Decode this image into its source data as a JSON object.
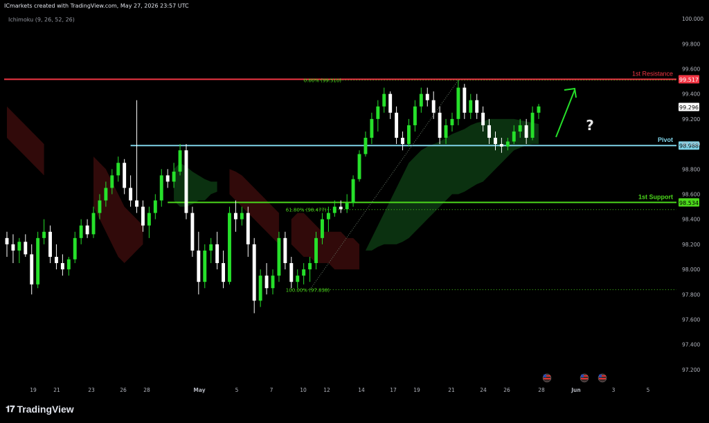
{
  "header": {
    "attribution": "ICmarkets created with TradingView.com, May 27, 2026 23:57 UTC",
    "indicator": "Ichimoku (9, 26, 52, 26)"
  },
  "brand": {
    "logo_icon": "tradingview-logo-icon",
    "name": "TradingView"
  },
  "colors": {
    "background": "#000000",
    "resistance": "#f23645",
    "pivot": "#7fd3e8",
    "support": "#4cd91c",
    "fib": "#4cd91c",
    "candle_up": "#26e02a",
    "candle_down": "#ffffff",
    "kumo_bull": "#0d3a13",
    "kumo_bear": "#3a0c0c",
    "arrow": "#26e02a"
  },
  "chart_data": {
    "type": "candlestick",
    "symbol_timeframe": "",
    "ylim": [
      97.1,
      100.05
    ],
    "y_ticks": [
      "100.000",
      "99.800",
      "99.600",
      "99.400",
      "99.200",
      "99.000",
      "98.800",
      "98.600",
      "98.400",
      "98.200",
      "98.000",
      "97.800",
      "97.600",
      "97.400",
      "97.200"
    ],
    "x_ticks": [
      "19",
      "21",
      "23",
      "26",
      "28",
      "May",
      "5",
      "7",
      "10",
      "12",
      "14",
      "17",
      "19",
      "21",
      "24",
      "26",
      "28",
      "Jun",
      "3",
      "5"
    ],
    "levels": [
      {
        "name": "1st Resistance",
        "price_label": "99.517",
        "value": 99.517,
        "color_key": "resistance"
      },
      {
        "name": "Pivot",
        "price_label": "98.988",
        "value": 98.988,
        "color_key": "pivot"
      },
      {
        "name": "1st Support",
        "price_label": "98.534",
        "value": 98.534,
        "color_key": "support"
      }
    ],
    "current_price": {
      "price_label": "99.296",
      "value": 99.296
    },
    "fib_levels": [
      {
        "label": "0.00% (99.510)",
        "value": 99.51
      },
      {
        "label": "61.80% (98.477)",
        "value": 98.477
      },
      {
        "label": "100.00% (97.838)",
        "value": 97.838
      }
    ],
    "annotation": {
      "symbol": "?",
      "direction": "up"
    },
    "event_markers": [
      "us-flag-icon",
      "us-flag-icon",
      "us-flag-icon"
    ],
    "candles": [
      [
        98.25,
        98.3,
        98.1,
        98.2
      ],
      [
        98.2,
        98.28,
        98.05,
        98.15
      ],
      [
        98.15,
        98.25,
        98.05,
        98.22
      ],
      [
        98.22,
        98.28,
        98.1,
        98.12
      ],
      [
        98.12,
        98.2,
        97.8,
        97.88
      ],
      [
        97.88,
        98.3,
        97.85,
        98.25
      ],
      [
        98.25,
        98.4,
        98.2,
        98.3
      ],
      [
        98.3,
        98.35,
        98.05,
        98.1
      ],
      [
        98.1,
        98.2,
        98.0,
        98.05
      ],
      [
        98.05,
        98.12,
        97.95,
        98.0
      ],
      [
        98.0,
        98.1,
        97.95,
        98.08
      ],
      [
        98.08,
        98.3,
        98.05,
        98.25
      ],
      [
        98.25,
        98.4,
        98.2,
        98.35
      ],
      [
        98.35,
        98.4,
        98.25,
        98.28
      ],
      [
        98.28,
        98.5,
        98.25,
        98.45
      ],
      [
        98.45,
        98.6,
        98.4,
        98.55
      ],
      [
        98.55,
        98.7,
        98.5,
        98.65
      ],
      [
        98.65,
        98.8,
        98.6,
        98.75
      ],
      [
        98.75,
        98.9,
        98.7,
        98.85
      ],
      [
        98.85,
        98.88,
        98.6,
        98.65
      ],
      [
        98.65,
        98.75,
        98.5,
        98.55
      ],
      [
        98.55,
        99.35,
        98.45,
        98.5
      ],
      [
        98.5,
        98.55,
        98.3,
        98.35
      ],
      [
        98.35,
        98.5,
        98.25,
        98.45
      ],
      [
        98.45,
        98.6,
        98.4,
        98.55
      ],
      [
        98.55,
        98.8,
        98.5,
        98.75
      ],
      [
        98.75,
        98.8,
        98.65,
        98.7
      ],
      [
        98.7,
        98.85,
        98.65,
        98.78
      ],
      [
        98.78,
        99.0,
        98.75,
        98.95
      ],
      [
        98.95,
        99.0,
        98.4,
        98.45
      ],
      [
        98.45,
        98.5,
        98.1,
        98.15
      ],
      [
        98.15,
        98.3,
        97.8,
        97.9
      ],
      [
        97.9,
        98.2,
        97.85,
        98.15
      ],
      [
        98.15,
        98.25,
        98.05,
        98.2
      ],
      [
        98.2,
        98.3,
        98.0,
        98.05
      ],
      [
        98.05,
        98.15,
        97.85,
        97.9
      ],
      [
        97.9,
        98.5,
        97.88,
        98.45
      ],
      [
        98.45,
        98.55,
        98.3,
        98.4
      ],
      [
        98.4,
        98.5,
        98.35,
        98.45
      ],
      [
        98.45,
        98.5,
        98.1,
        98.2
      ],
      [
        98.2,
        98.25,
        97.65,
        97.75
      ],
      [
        97.75,
        98.0,
        97.7,
        97.95
      ],
      [
        97.95,
        98.05,
        97.8,
        97.85
      ],
      [
        97.85,
        98.0,
        97.8,
        97.95
      ],
      [
        97.95,
        98.3,
        97.9,
        98.25
      ],
      [
        98.25,
        98.3,
        98.0,
        98.05
      ],
      [
        98.05,
        98.1,
        97.85,
        97.9
      ],
      [
        97.9,
        98.0,
        97.85,
        97.95
      ],
      [
        97.95,
        98.05,
        97.88,
        98.0
      ],
      [
        98.0,
        98.1,
        97.9,
        98.05
      ],
      [
        98.05,
        98.3,
        98.0,
        98.25
      ],
      [
        98.25,
        98.45,
        98.2,
        98.4
      ],
      [
        98.4,
        98.5,
        98.3,
        98.45
      ],
      [
        98.45,
        98.55,
        98.42,
        98.5
      ],
      [
        98.5,
        98.55,
        98.45,
        98.48
      ],
      [
        98.48,
        98.6,
        98.45,
        98.53
      ],
      [
        98.53,
        98.75,
        98.5,
        98.72
      ],
      [
        98.72,
        98.95,
        98.7,
        98.92
      ],
      [
        98.92,
        99.1,
        98.9,
        99.05
      ],
      [
        99.05,
        99.25,
        99.0,
        99.2
      ],
      [
        99.2,
        99.35,
        99.1,
        99.3
      ],
      [
        99.3,
        99.45,
        99.25,
        99.4
      ],
      [
        99.4,
        99.42,
        99.2,
        99.25
      ],
      [
        99.25,
        99.3,
        99.0,
        99.05
      ],
      [
        99.05,
        99.1,
        98.95,
        99.0
      ],
      [
        99.0,
        99.2,
        98.98,
        99.15
      ],
      [
        99.15,
        99.35,
        99.1,
        99.3
      ],
      [
        99.3,
        99.45,
        99.25,
        99.4
      ],
      [
        99.4,
        99.45,
        99.3,
        99.35
      ],
      [
        99.35,
        99.42,
        99.2,
        99.25
      ],
      [
        99.25,
        99.3,
        99.0,
        99.05
      ],
      [
        99.05,
        99.2,
        99.0,
        99.15
      ],
      [
        99.15,
        99.25,
        99.1,
        99.2
      ],
      [
        99.2,
        99.51,
        99.15,
        99.45
      ],
      [
        99.45,
        99.48,
        99.2,
        99.25
      ],
      [
        99.25,
        99.4,
        99.2,
        99.35
      ],
      [
        99.35,
        99.4,
        99.2,
        99.25
      ],
      [
        99.25,
        99.3,
        99.1,
        99.15
      ],
      [
        99.15,
        99.2,
        99.0,
        99.05
      ],
      [
        99.05,
        99.1,
        98.95,
        99.0
      ],
      [
        99.0,
        99.05,
        98.93,
        98.98
      ],
      [
        98.98,
        99.05,
        98.95,
        99.02
      ],
      [
        99.02,
        99.15,
        99.0,
        99.1
      ],
      [
        99.1,
        99.2,
        99.05,
        99.15
      ],
      [
        99.15,
        99.2,
        99.0,
        99.05
      ],
      [
        99.05,
        99.3,
        99.03,
        99.25
      ],
      [
        99.25,
        99.32,
        99.2,
        99.3
      ]
    ],
    "kumo": [
      {
        "from": 0,
        "to": 6,
        "top": [
          99.3,
          99.25,
          99.2,
          99.15,
          99.1,
          99.05,
          99.0
        ],
        "bottom": [
          99.05,
          99.0,
          98.95,
          98.9,
          98.85,
          98.8,
          98.75
        ],
        "color_key": "kumo_bear"
      },
      {
        "from": 14,
        "to": 22,
        "top": [
          98.9,
          98.85,
          98.8,
          98.7,
          98.6,
          98.5,
          98.45,
          98.4,
          98.35
        ],
        "bottom": [
          98.5,
          98.4,
          98.3,
          98.2,
          98.1,
          98.05,
          98.1,
          98.15,
          98.2
        ],
        "color_key": "kumo_bear"
      },
      {
        "from": 27,
        "to": 34,
        "top": [
          98.8,
          98.85,
          98.82,
          98.78,
          98.75,
          98.72,
          98.7,
          98.7
        ],
        "bottom": [
          98.55,
          98.5,
          98.5,
          98.52,
          98.55,
          98.55,
          98.6,
          98.62
        ],
        "color_key": "kumo_bull"
      },
      {
        "from": 36,
        "to": 44,
        "top": [
          98.8,
          98.78,
          98.75,
          98.7,
          98.65,
          98.6,
          98.55,
          98.5,
          98.45
        ],
        "bottom": [
          98.6,
          98.55,
          98.5,
          98.45,
          98.4,
          98.35,
          98.3,
          98.25,
          98.2
        ],
        "color_key": "kumo_bear"
      },
      {
        "from": 46,
        "to": 57,
        "top": [
          98.4,
          98.45,
          98.45,
          98.4,
          98.35,
          98.3,
          98.3,
          98.3,
          98.3,
          98.25,
          98.25,
          98.2
        ],
        "bottom": [
          98.2,
          98.15,
          98.1,
          98.1,
          98.05,
          98.05,
          98.05,
          98.0,
          98.0,
          98.0,
          98.0,
          98.0
        ],
        "color_key": "kumo_bear"
      },
      {
        "from": 58,
        "to": 86,
        "top": [
          98.15,
          98.25,
          98.35,
          98.45,
          98.55,
          98.65,
          98.75,
          98.85,
          98.9,
          98.95,
          98.98,
          99.0,
          99.02,
          99.05,
          99.08,
          99.1,
          99.12,
          99.15,
          99.17,
          99.18,
          99.2,
          99.2,
          99.2,
          99.2,
          99.2,
          99.19,
          99.18,
          99.17,
          99.16
        ],
        "bottom": [
          98.15,
          98.15,
          98.18,
          98.2,
          98.2,
          98.2,
          98.22,
          98.25,
          98.3,
          98.35,
          98.4,
          98.45,
          98.5,
          98.55,
          98.6,
          98.6,
          98.62,
          98.65,
          98.68,
          98.7,
          98.75,
          98.8,
          98.85,
          98.9,
          98.95,
          98.97,
          98.99,
          99.0,
          99.0
        ],
        "color_key": "kumo_bull"
      }
    ]
  }
}
